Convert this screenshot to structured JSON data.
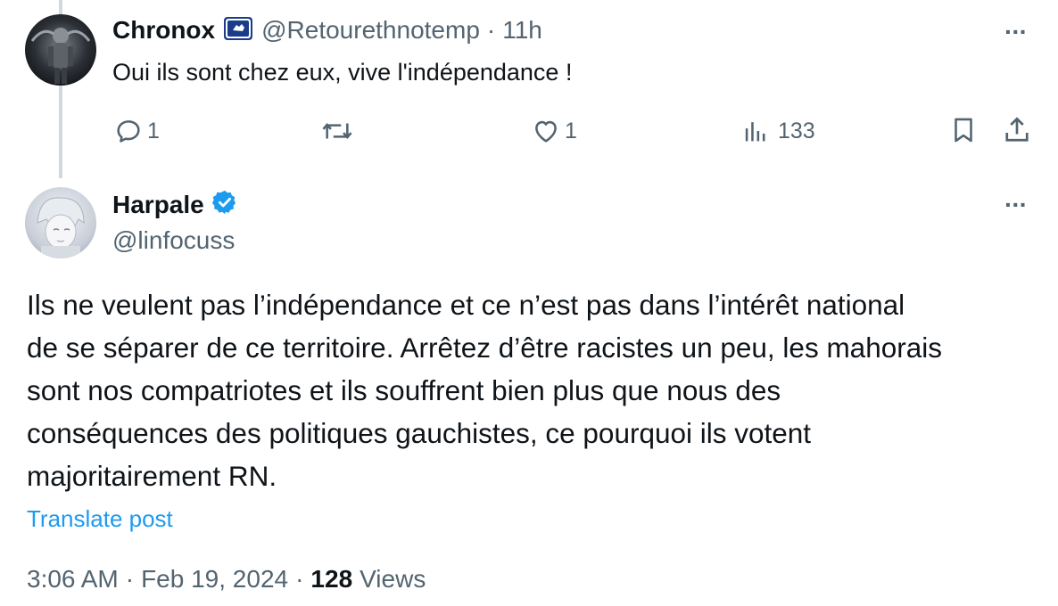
{
  "reply": {
    "display_name": "Chronox",
    "handle": "@Retourethnotemp",
    "separator": "·",
    "time": "11h",
    "text": "Oui ils sont chez eux, vive l'indépendance !",
    "more_label": "···",
    "actions": {
      "replies": "1",
      "reposts": "",
      "likes": "1",
      "views": "133"
    }
  },
  "post": {
    "display_name": "Harpale",
    "handle": "@linfocuss",
    "more_label": "···",
    "lines": [
      "Ils ne veulent pas l’indépendance et ce n’est pas dans l’intérêt national",
      "de se séparer de ce territoire. Arrêtez d’être racistes un peu, les mahorais",
      "sont nos compatriotes et ils souffrent bien plus que nous des",
      "conséquences des politiques gauchistes, ce pourquoi ils votent",
      "majoritairement RN."
    ],
    "translate_label": "Translate post",
    "time": "3:06 AM",
    "sep1": "·",
    "date": "Feb 19, 2024",
    "sep2": "·",
    "views_count": "128",
    "views_label": "Views"
  },
  "colors": {
    "text": "#0f1419",
    "secondary": "#536471",
    "accent": "#1d9bf0",
    "badge_blue": "#1d9bf0",
    "affiliate_badge": "#1a3c8a"
  },
  "icons": {
    "reply": "reply-icon",
    "repost": "repost-icon",
    "like": "heart-icon",
    "views": "bar-chart-icon",
    "bookmark": "bookmark-icon",
    "share": "share-icon",
    "verified": "verified-badge-icon",
    "affiliate": "affiliate-badge-icon"
  }
}
